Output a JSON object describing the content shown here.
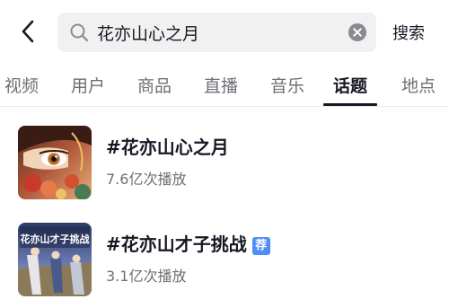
{
  "search": {
    "query": "花亦山心之月",
    "submit_label": "搜索"
  },
  "tabs": [
    {
      "label": "视频",
      "active": false
    },
    {
      "label": "用户",
      "active": false
    },
    {
      "label": "商品",
      "active": false
    },
    {
      "label": "直播",
      "active": false
    },
    {
      "label": "音乐",
      "active": false
    },
    {
      "label": "话题",
      "active": true
    },
    {
      "label": "地点",
      "active": false
    }
  ],
  "results": [
    {
      "title": "#花亦山心之月",
      "stats": "7.6亿次播放",
      "badge": ""
    },
    {
      "title": "#花亦山才子挑战",
      "stats": "3.1亿次播放",
      "badge": "荐",
      "thumb_text": "花亦山才子挑战"
    }
  ],
  "icons": {
    "back": "chevron-left-icon",
    "search": "search-icon",
    "clear": "clear-icon"
  },
  "colors": {
    "text_primary": "#161823",
    "text_secondary": "#6e6f75",
    "search_bg": "#f1f1f2",
    "badge_blue": "#4f8ef7"
  }
}
